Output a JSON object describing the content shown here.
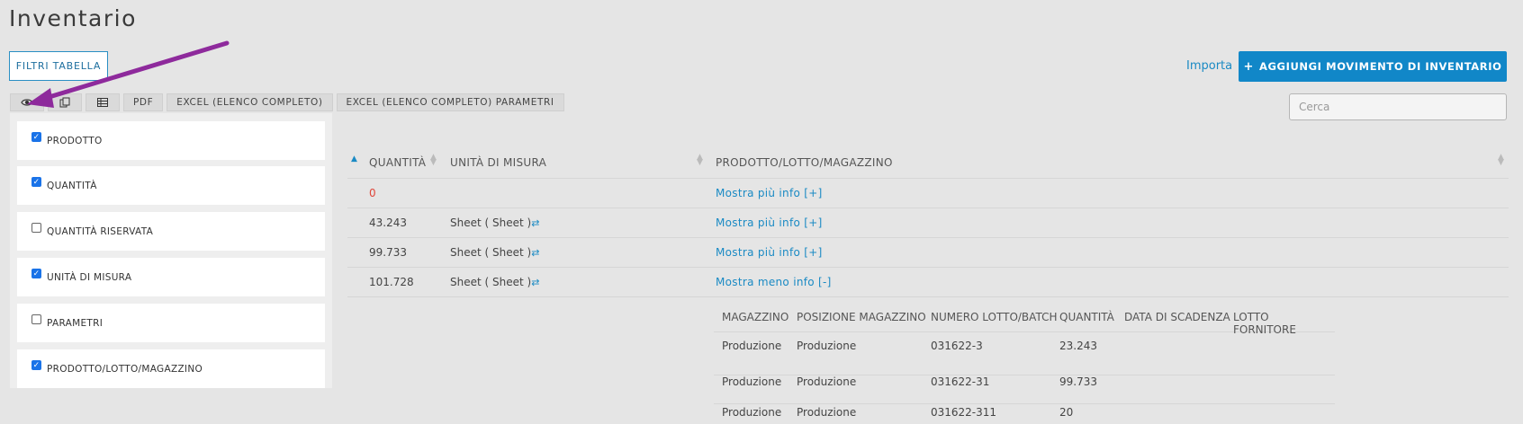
{
  "page": {
    "title": "Inventario"
  },
  "toolbar": {
    "filter_label": "FILTRI TABELLA",
    "import_label": "Importa",
    "add_label": "AGGIUNGI MOVIMENTO DI INVENTARIO",
    "add_plus": "+",
    "pdf_label": "PDF",
    "excel_label": "EXCEL (ELENCO COMPLETO)",
    "excel_params_label": "EXCEL (ELENCO COMPLETO) PARAMETRI"
  },
  "search": {
    "placeholder": "Cerca"
  },
  "columns_panel": {
    "items": [
      {
        "label": "PRODOTTO",
        "checked": "✓"
      },
      {
        "label": "QUANTITÀ",
        "checked": "✓"
      },
      {
        "label": "QUANTITÀ RISERVATA",
        "checked": ""
      },
      {
        "label": "UNITÀ DI MISURA",
        "checked": "✓"
      },
      {
        "label": "PARAMETRI",
        "checked": ""
      },
      {
        "label": "PRODOTTO/LOTTO/MAGAZZINO",
        "checked": "✓"
      }
    ]
  },
  "table": {
    "headers": {
      "qty": "QUANTITÀ",
      "unit": "UNITÀ DI MISURA",
      "product": "PRODOTTO/LOTTO/MAGAZZINO"
    },
    "rows": [
      {
        "qty": "0",
        "unit": "",
        "info": "Mostra più info [+]"
      },
      {
        "qty": "43.243",
        "unit": "Sheet ( Sheet )",
        "info": "Mostra più info [+]"
      },
      {
        "qty": "99.733",
        "unit": "Sheet ( Sheet )",
        "info": "Mostra più info [+]"
      },
      {
        "qty": "101.728",
        "unit": "Sheet ( Sheet )",
        "info": "Mostra meno info [-]"
      }
    ],
    "swap_icon": "⇄"
  },
  "subtable": {
    "headers": {
      "warehouse": "MAGAZZINO",
      "position": "POSIZIONE MAGAZZINO",
      "batch": "NUMERO LOTTO/BATCH",
      "qty": "QUANTITÀ",
      "expiry": "DATA DI SCADENZA",
      "supplier_lot": "LOTTO FORNITORE"
    },
    "rows": [
      {
        "warehouse": "Produzione",
        "position": "Produzione",
        "batch": "031622-3",
        "qty": "23.243"
      },
      {
        "warehouse": "Produzione",
        "position": "Produzione",
        "batch": "031622-31",
        "qty": "99.733"
      },
      {
        "warehouse": "Produzione",
        "position": "Produzione",
        "batch": "031622-311",
        "qty": "20"
      }
    ]
  },
  "colors": {
    "accent": "#1187c8",
    "link": "#1a8ac4",
    "annotation_arrow": "#8e2a9c",
    "zero_qty": "#e0463a"
  }
}
